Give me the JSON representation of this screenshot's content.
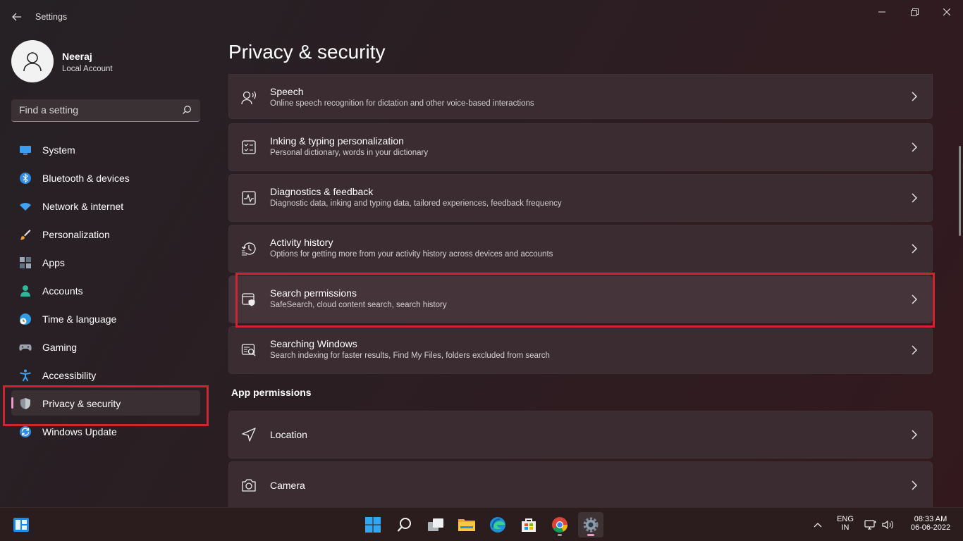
{
  "window": {
    "title": "Settings",
    "controls": {
      "minimize": "minimize-icon",
      "maximize": "restore-icon",
      "close": "close-icon"
    }
  },
  "profile": {
    "name": "Neeraj",
    "account_type": "Local Account"
  },
  "search": {
    "placeholder": "Find a setting"
  },
  "sidebar": {
    "items": [
      {
        "label": "System",
        "icon": "system-icon"
      },
      {
        "label": "Bluetooth & devices",
        "icon": "bluetooth-icon"
      },
      {
        "label": "Network & internet",
        "icon": "wifi-icon"
      },
      {
        "label": "Personalization",
        "icon": "brush-icon"
      },
      {
        "label": "Apps",
        "icon": "apps-icon"
      },
      {
        "label": "Accounts",
        "icon": "person-icon"
      },
      {
        "label": "Time & language",
        "icon": "globe-clock-icon"
      },
      {
        "label": "Gaming",
        "icon": "controller-icon"
      },
      {
        "label": "Accessibility",
        "icon": "accessibility-icon"
      },
      {
        "label": "Privacy & security",
        "icon": "shield-icon",
        "active": true
      },
      {
        "label": "Windows Update",
        "icon": "update-icon"
      }
    ]
  },
  "main": {
    "title": "Privacy & security",
    "items": [
      {
        "title": "Speech",
        "subtitle": "Online speech recognition for dictation and other voice-based interactions",
        "icon": "speech-icon"
      },
      {
        "title": "Inking & typing personalization",
        "subtitle": "Personal dictionary, words in your dictionary",
        "icon": "inking-icon"
      },
      {
        "title": "Diagnostics & feedback",
        "subtitle": "Diagnostic data, inking and typing data, tailored experiences, feedback frequency",
        "icon": "diagnostics-icon"
      },
      {
        "title": "Activity history",
        "subtitle": "Options for getting more from your activity history across devices and accounts",
        "icon": "history-icon"
      },
      {
        "title": "Search permissions",
        "subtitle": "SafeSearch, cloud content search, search history",
        "icon": "search-shield-icon"
      },
      {
        "title": "Searching Windows",
        "subtitle": "Search indexing for faster results, Find My Files, folders excluded from search",
        "icon": "search-windows-icon"
      }
    ],
    "app_permissions": {
      "heading": "App permissions",
      "items": [
        {
          "title": "Location",
          "icon": "location-icon"
        },
        {
          "title": "Camera",
          "icon": "camera-icon"
        }
      ]
    }
  },
  "taskbar": {
    "apps": [
      "start-icon",
      "search-icon",
      "task-view-icon",
      "file-explorer-icon",
      "edge-icon",
      "store-icon",
      "chrome-icon",
      "settings-icon"
    ],
    "tray": {
      "lang_line1": "ENG",
      "lang_line2": "IN",
      "time": "08:33 AM",
      "date": "06-06-2022"
    }
  },
  "colors": {
    "accent": "#e79bc4",
    "highlight": "#d1242f",
    "card_bg": "#3a2c31"
  }
}
